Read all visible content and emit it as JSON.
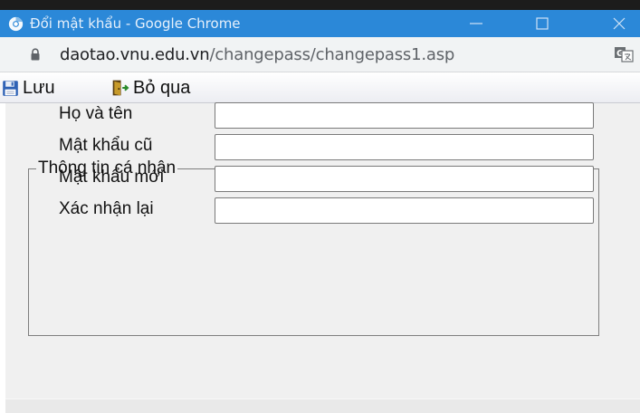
{
  "window": {
    "title": "Đổi mật khẩu - Google Chrome"
  },
  "address_bar": {
    "host": "daotao.vnu.edu.vn",
    "path": "/changepass/changepass1.asp"
  },
  "toolbar": {
    "save_label": "Lưu",
    "skip_label": "Bỏ qua"
  },
  "form": {
    "legend": "Thông tin cá nhân",
    "fields": [
      {
        "label": "Họ và tên",
        "value": ""
      },
      {
        "label": "Mật khẩu cũ",
        "value": ""
      },
      {
        "label": "Mật khẩu mới",
        "value": ""
      },
      {
        "label": "Xác nhận lại",
        "value": ""
      }
    ]
  },
  "icons": {
    "browser": "chrome-icon",
    "secure": "lock-icon",
    "translate": "translate-icon",
    "save": "floppy-disk-icon",
    "skip": "exit-door-icon"
  },
  "colors": {
    "titlebar": "#2b88d8",
    "content_bg": "#f0f0f0"
  }
}
